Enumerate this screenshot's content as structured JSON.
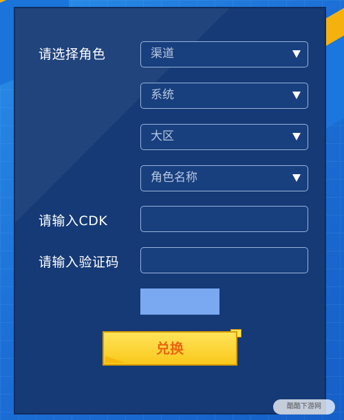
{
  "form": {
    "select_role_label": "请选择角色",
    "channel_placeholder": "渠道",
    "system_placeholder": "系统",
    "region_placeholder": "大区",
    "role_name_placeholder": "角色名称",
    "cdk_label": "请输入CDK",
    "captcha_label": "请输入验证码",
    "redeem_label": "兑换"
  },
  "watermark": {
    "text": "酷酷下游网"
  },
  "colors": {
    "panel": "#153a76",
    "field_border": "#9ab6dc",
    "button": "#f9c81a",
    "button_text": "#e86612",
    "captcha": "#7aa9f2"
  },
  "icons": {
    "dropdown": "caret-down-icon"
  }
}
